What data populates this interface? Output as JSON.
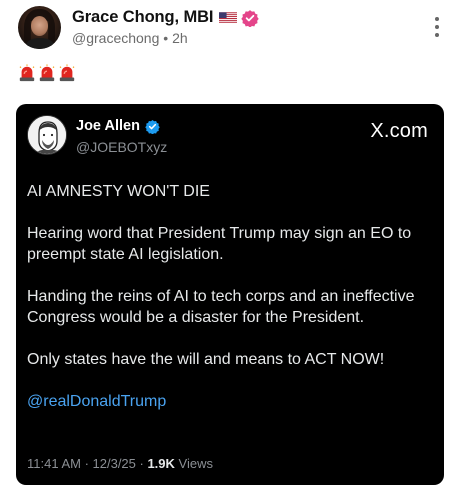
{
  "post": {
    "author_name": "Grace Chong, MBI",
    "handle": "@gracechong",
    "separator": "•",
    "time": "2h",
    "flag_icon": "us-flag-icon",
    "badge_color": "#e4458a",
    "body_emoji": "🚨🚨🚨"
  },
  "embed": {
    "author_name": "Joe Allen",
    "handle": "@JOEBOTxyz",
    "source": "X.com",
    "badge_color": "#1d9bf0",
    "paragraphs": [
      "AI AMNESTY WON'T DIE",
      "Hearing word that President Trump may sign an EO to preempt state AI legislation.",
      "Handing the reins of AI to tech corps and an ineffective Congress would be a disaster for the President.",
      "Only states have the will and means to ACT NOW!"
    ],
    "mention": "@realDonaldTrump",
    "timestamp": "11:41 AM · 12/3/25 · ",
    "views_count": "1.9K",
    "views_label": " Views"
  }
}
